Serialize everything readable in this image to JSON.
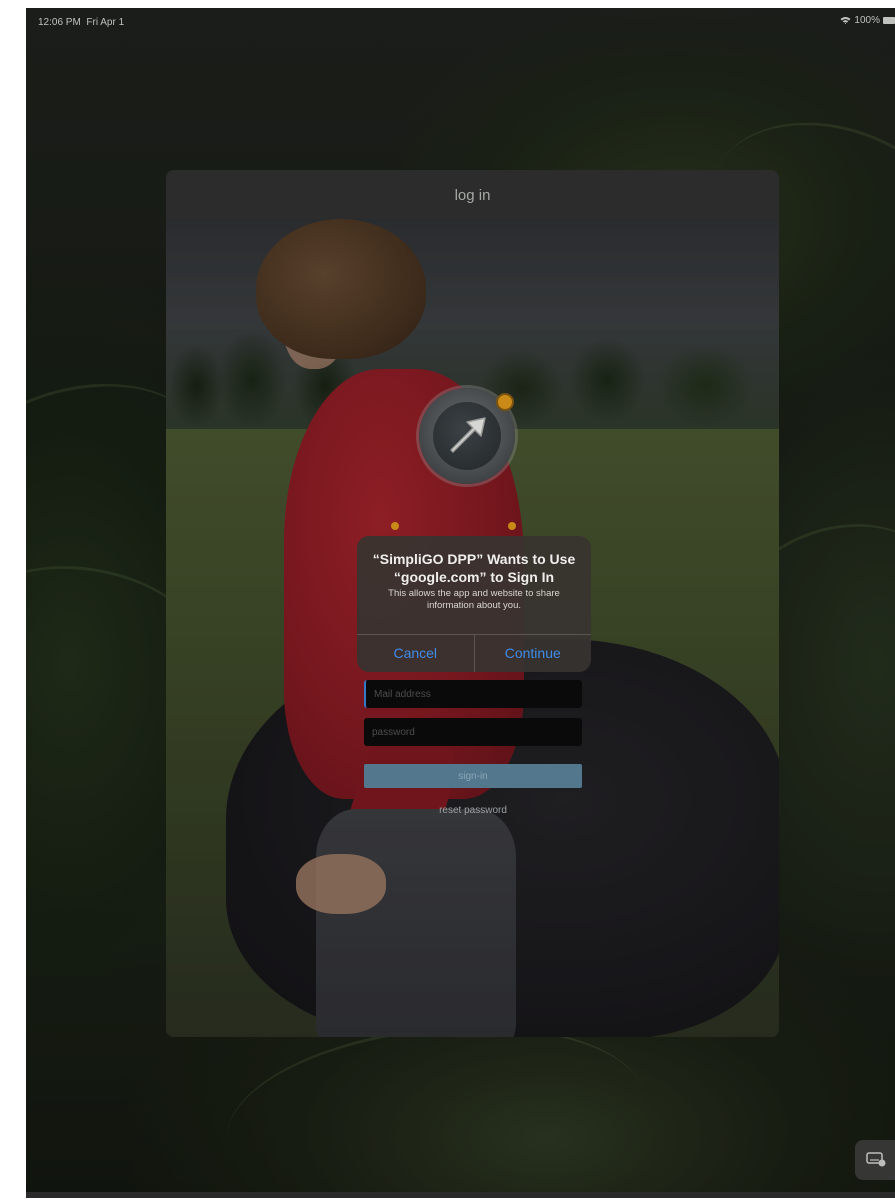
{
  "status_bar": {
    "time": "12:06 PM",
    "date": "Fri Apr 1",
    "battery": "100%"
  },
  "sheet": {
    "title": "log in"
  },
  "login_form": {
    "email_placeholder": "Mail address",
    "password_placeholder": "password",
    "signin_label": "sign-in",
    "reset_label": "reset password"
  },
  "alert": {
    "title": "“SimpliGO DPP” Wants to Use “google.com” to Sign In",
    "message": "This allows the app and website to share information about you.",
    "cancel_label": "Cancel",
    "continue_label": "Continue"
  },
  "colors": {
    "alert_button": "#3e8ce8",
    "signin_button": "#53788e",
    "logo_accent": "#c98a18"
  },
  "icons": [
    "wifi-icon",
    "battery-icon",
    "app-logo-arrow-icon",
    "keyboard-icon"
  ]
}
